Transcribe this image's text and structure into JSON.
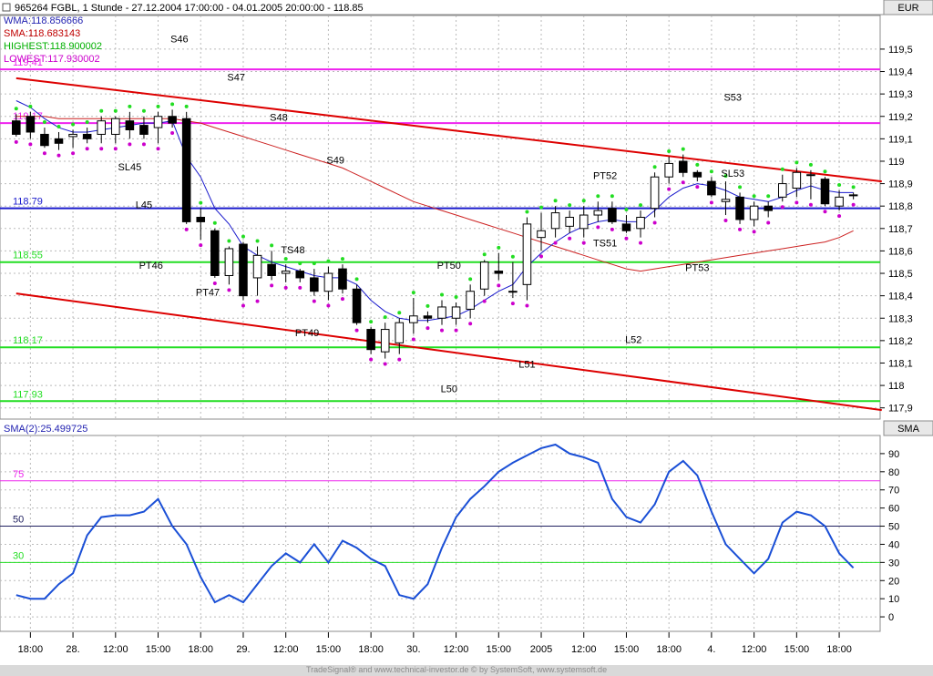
{
  "header": {
    "symbol_line": "965264 FGBL, 1 Stunde - 27.12.2004 17:00:00 - 04.01.2005 20:00:00 - 118.85",
    "currency": "EUR",
    "indicator_tab": "SMA"
  },
  "legend": [
    {
      "text": "WMA:118.856666",
      "color": "#1f1fb0"
    },
    {
      "text": "SMA:118.683143",
      "color": "#c00000"
    },
    {
      "text": "HIGHEST:118.900002",
      "color": "#00b000"
    },
    {
      "text": "LOWEST:117.930002",
      "color": "#cc00cc"
    }
  ],
  "footer_text": "TradeSignal® and www.technical-investor.de © by SystemSoft, www.systemsoft.de",
  "colors": {
    "wma": "#1a1acc",
    "sma": "#cc2020",
    "trend": "#dd0000",
    "magenta": "#ee22ee",
    "green": "#22dd22",
    "blue_level": "#1a1acc",
    "osc": "#1a4fd6"
  },
  "chart_data": [
    {
      "type": "candlestick",
      "title": "965264 FGBL, 1 Stunde - 27.12.2004 17:00:00 - 04.01.2005 20:00:00 - 118.85",
      "ylim": [
        117.85,
        119.65
      ],
      "yticks": [
        117.9,
        118,
        118.1,
        118.2,
        118.3,
        118.4,
        118.5,
        118.6,
        118.7,
        118.8,
        118.9,
        119,
        119.1,
        119.2,
        119.3,
        119.4,
        119.5
      ],
      "ytick_labels": [
        "117,9",
        "118",
        "118,1",
        "118,2",
        "118,3",
        "118,4",
        "118,5",
        "118,6",
        "118,7",
        "118,8",
        "118,9",
        "119",
        "119,1",
        "119,2",
        "119,3",
        "119,4",
        "119,5"
      ],
      "xtick_labels": [
        {
          "i": 1,
          "label": "18:00"
        },
        {
          "i": 4,
          "label": "28."
        },
        {
          "i": 7,
          "label": "12:00"
        },
        {
          "i": 10,
          "label": "15:00"
        },
        {
          "i": 13,
          "label": "18:00"
        },
        {
          "i": 16,
          "label": "29."
        },
        {
          "i": 19,
          "label": "12:00"
        },
        {
          "i": 22,
          "label": "15:00"
        },
        {
          "i": 25,
          "label": "18:00"
        },
        {
          "i": 28,
          "label": "30."
        },
        {
          "i": 31,
          "label": "12:00"
        },
        {
          "i": 34,
          "label": "15:00"
        },
        {
          "i": 37,
          "label": "2005"
        },
        {
          "i": 40,
          "label": "12:00"
        },
        {
          "i": 43,
          "label": "15:00"
        },
        {
          "i": 46,
          "label": "18:00"
        },
        {
          "i": 49,
          "label": "4."
        },
        {
          "i": 52,
          "label": "12:00"
        },
        {
          "i": 55,
          "label": "15:00"
        },
        {
          "i": 58,
          "label": "18:00"
        }
      ],
      "candles": [
        [
          119.18,
          119.21,
          119.11,
          119.12
        ],
        [
          119.2,
          119.22,
          119.1,
          119.13
        ],
        [
          119.12,
          119.15,
          119.06,
          119.07
        ],
        [
          119.1,
          119.13,
          119.05,
          119.08
        ],
        [
          119.11,
          119.14,
          119.06,
          119.12
        ],
        [
          119.12,
          119.15,
          119.08,
          119.1
        ],
        [
          119.12,
          119.2,
          119.08,
          119.18
        ],
        [
          119.12,
          119.2,
          119.08,
          119.19
        ],
        [
          119.18,
          119.22,
          119.1,
          119.14
        ],
        [
          119.16,
          119.2,
          119.1,
          119.12
        ],
        [
          119.15,
          119.22,
          119.08,
          119.2
        ],
        [
          119.2,
          119.23,
          119.15,
          119.17
        ],
        [
          119.19,
          119.22,
          118.72,
          118.73
        ],
        [
          118.75,
          118.79,
          118.65,
          118.73
        ],
        [
          118.69,
          118.7,
          118.48,
          118.49
        ],
        [
          118.49,
          118.62,
          118.45,
          118.61
        ],
        [
          118.63,
          118.64,
          118.38,
          118.4
        ],
        [
          118.48,
          118.62,
          118.4,
          118.58
        ],
        [
          118.54,
          118.6,
          118.47,
          118.49
        ],
        [
          118.5,
          118.54,
          118.46,
          118.51
        ],
        [
          118.51,
          118.52,
          118.46,
          118.48
        ],
        [
          118.48,
          118.52,
          118.4,
          118.42
        ],
        [
          118.42,
          118.53,
          118.38,
          118.5
        ],
        [
          118.52,
          118.54,
          118.41,
          118.43
        ],
        [
          118.43,
          118.45,
          118.27,
          118.28
        ],
        [
          118.25,
          118.26,
          118.14,
          118.16
        ],
        [
          118.15,
          118.28,
          118.12,
          118.25
        ],
        [
          118.19,
          118.3,
          118.14,
          118.28
        ],
        [
          118.28,
          118.39,
          118.23,
          118.31
        ],
        [
          118.31,
          118.33,
          118.28,
          118.3
        ],
        [
          118.3,
          118.38,
          118.27,
          118.35
        ],
        [
          118.3,
          118.37,
          118.27,
          118.35
        ],
        [
          118.34,
          118.45,
          118.3,
          118.42
        ],
        [
          118.43,
          118.56,
          118.4,
          118.55
        ],
        [
          118.51,
          118.59,
          118.47,
          118.5
        ],
        [
          118.42,
          118.55,
          118.39,
          118.42
        ],
        [
          118.45,
          118.75,
          118.38,
          118.72
        ],
        [
          118.66,
          118.77,
          118.6,
          118.69
        ],
        [
          118.7,
          118.8,
          118.66,
          118.77
        ],
        [
          118.71,
          118.78,
          118.68,
          118.75
        ],
        [
          118.7,
          118.8,
          118.66,
          118.76
        ],
        [
          118.76,
          118.82,
          118.73,
          118.78
        ],
        [
          118.79,
          118.82,
          118.72,
          118.73
        ],
        [
          118.72,
          118.76,
          118.68,
          118.69
        ],
        [
          118.7,
          118.78,
          118.66,
          118.75
        ],
        [
          118.79,
          118.95,
          118.75,
          118.93
        ],
        [
          118.93,
          119.02,
          118.9,
          118.99
        ],
        [
          119.0,
          119.03,
          118.93,
          118.95
        ],
        [
          118.95,
          118.96,
          118.91,
          118.93
        ],
        [
          118.91,
          118.93,
          118.84,
          118.85
        ],
        [
          118.82,
          118.91,
          118.76,
          118.83
        ],
        [
          118.84,
          118.86,
          118.72,
          118.74
        ],
        [
          118.74,
          118.82,
          118.71,
          118.8
        ],
        [
          118.8,
          118.82,
          118.75,
          118.78
        ],
        [
          118.84,
          118.94,
          118.82,
          118.9
        ],
        [
          118.88,
          118.97,
          118.84,
          118.95
        ],
        [
          118.94,
          118.96,
          118.83,
          118.94
        ],
        [
          118.92,
          118.93,
          118.8,
          118.81
        ],
        [
          118.8,
          118.87,
          118.78,
          118.84
        ],
        [
          118.85,
          118.86,
          118.83,
          118.85
        ]
      ],
      "series": [
        {
          "name": "WMA",
          "values": [
            119.27,
            119.24,
            119.19,
            119.15,
            119.13,
            119.13,
            119.14,
            119.15,
            119.16,
            119.17,
            119.17,
            119.18,
            119.02,
            118.93,
            118.79,
            118.72,
            118.62,
            118.58,
            118.55,
            118.53,
            118.51,
            118.49,
            118.48,
            118.48,
            118.45,
            118.38,
            118.33,
            118.3,
            118.29,
            118.29,
            118.3,
            118.31,
            118.34,
            118.38,
            118.42,
            118.45,
            118.53,
            118.59,
            118.64,
            118.68,
            118.71,
            118.73,
            118.74,
            118.73,
            118.73,
            118.78,
            118.84,
            118.88,
            118.9,
            118.89,
            118.87,
            118.84,
            118.83,
            118.82,
            118.84,
            118.87,
            118.89,
            118.87,
            118.86,
            118.86
          ]
        },
        {
          "name": "SMA",
          "values": [
            119.2,
            119.2,
            119.2,
            119.19,
            119.19,
            119.19,
            119.19,
            119.19,
            119.19,
            119.19,
            119.19,
            119.19,
            119.18,
            119.17,
            119.15,
            119.13,
            119.11,
            119.09,
            119.07,
            119.05,
            119.03,
            119.01,
            118.99,
            118.97,
            118.94,
            118.91,
            118.88,
            118.85,
            118.82,
            118.8,
            118.78,
            118.76,
            118.74,
            118.72,
            118.7,
            118.68,
            118.66,
            118.64,
            118.62,
            118.6,
            118.58,
            118.56,
            118.54,
            118.52,
            118.51,
            118.52,
            118.53,
            118.54,
            118.55,
            118.56,
            118.57,
            118.58,
            118.59,
            118.6,
            118.61,
            118.62,
            118.63,
            118.64,
            118.66,
            118.69
          ]
        }
      ],
      "levels": [
        {
          "value": 118.79,
          "label": "118.79",
          "color": "blue"
        },
        {
          "value": 118.55,
          "label": "118.55",
          "color": "green"
        },
        {
          "value": 118.17,
          "label": "118.17",
          "color": "green"
        },
        {
          "value": 117.93,
          "label": "117.93",
          "color": "green"
        },
        {
          "value": 119.17,
          "label": "119.17",
          "color": "magenta"
        },
        {
          "value": 119.41,
          "label": "119.41",
          "color": "magenta"
        }
      ],
      "trendlines": [
        {
          "from": [
            0,
            119.37
          ],
          "to": [
            61,
            118.91
          ]
        },
        {
          "from": [
            0,
            118.41
          ],
          "to": [
            61,
            117.89
          ]
        }
      ],
      "annotations": [
        {
          "text": "S46",
          "i": 11.5,
          "y": 119.53
        },
        {
          "text": "S47",
          "i": 15.5,
          "y": 119.36
        },
        {
          "text": "S48",
          "i": 18.5,
          "y": 119.18
        },
        {
          "text": "S49",
          "i": 22.5,
          "y": 118.99
        },
        {
          "text": "S53",
          "i": 50.5,
          "y": 119.27
        },
        {
          "text": "SL45",
          "i": 8,
          "y": 118.96
        },
        {
          "text": "SL53",
          "i": 50.5,
          "y": 118.93
        },
        {
          "text": "L45",
          "i": 9,
          "y": 118.79
        },
        {
          "text": "PT46",
          "i": 9.5,
          "y": 118.52
        },
        {
          "text": "PT47",
          "i": 13.5,
          "y": 118.4
        },
        {
          "text": "TS48",
          "i": 19.5,
          "y": 118.59
        },
        {
          "text": "PT49",
          "i": 20.5,
          "y": 118.22
        },
        {
          "text": "PT50",
          "i": 30.5,
          "y": 118.52
        },
        {
          "text": "PT52",
          "i": 41.5,
          "y": 118.92
        },
        {
          "text": "TS51",
          "i": 41.5,
          "y": 118.62
        },
        {
          "text": "PT53",
          "i": 48,
          "y": 118.51
        },
        {
          "text": "L50",
          "i": 30.5,
          "y": 117.97
        },
        {
          "text": "L51",
          "i": 36,
          "y": 118.08
        },
        {
          "text": "L52",
          "i": 43.5,
          "y": 118.19
        }
      ]
    },
    {
      "type": "line",
      "title": "SMA(2):25.499725",
      "ylim": [
        -8,
        100
      ],
      "yticks": [
        0,
        10,
        20,
        30,
        40,
        50,
        60,
        70,
        80,
        90
      ],
      "series": [
        {
          "name": "SMA(2)",
          "values": [
            12,
            10,
            10,
            18,
            24,
            45,
            55,
            56,
            56,
            58,
            65,
            50,
            40,
            22,
            8,
            12,
            8,
            18,
            28,
            35,
            30,
            40,
            30,
            42,
            38,
            32,
            28,
            12,
            10,
            18,
            38,
            55,
            65,
            72,
            80,
            85,
            89,
            93,
            95,
            90,
            88,
            85,
            65,
            55,
            52,
            62,
            80,
            86,
            78,
            58,
            40,
            32,
            24,
            32,
            52,
            58,
            56,
            50,
            35,
            27
          ]
        }
      ],
      "levels": [
        {
          "value": 75,
          "label": "75",
          "color": "magenta"
        },
        {
          "value": 50,
          "label": "50",
          "color": "navy"
        },
        {
          "value": 30,
          "label": "30",
          "color": "green"
        }
      ]
    }
  ]
}
